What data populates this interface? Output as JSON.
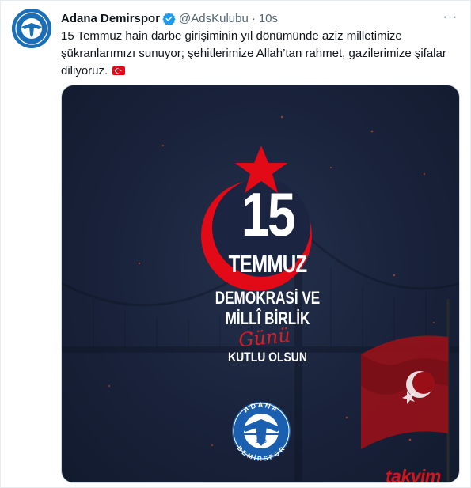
{
  "tweet": {
    "display_name": "Adana Demirspor",
    "handle": "@AdsKulubu",
    "separator": "·",
    "time": "10s",
    "more_label": "···",
    "text_line1": "15 Temmuz hain darbe girişiminin yıl dönümünde aziz milletimize",
    "text_line2": "şükranlarımızı sunuyor; şehitlerimize Allah’tan rahmet, gazilerimize şifalar",
    "text_line3": "diliyoruz.",
    "flag_icon": "turkey-flag-icon"
  },
  "poster": {
    "number": "15",
    "month": "TEMMUZ",
    "line1": "DEMOKRASİ VE",
    "line2": "MİLLÎ BİRLİK",
    "script_word": "Günü",
    "line3": "KUTLU OLSUN",
    "logo_top": "ADANA",
    "logo_bottom": "DEMİRSPOR",
    "logo_year": "1940"
  },
  "watermark": "takvim",
  "colors": {
    "accent_blue": "#1d9bf0",
    "turkish_red": "#e30a17",
    "poster_bg": "#19223a"
  }
}
